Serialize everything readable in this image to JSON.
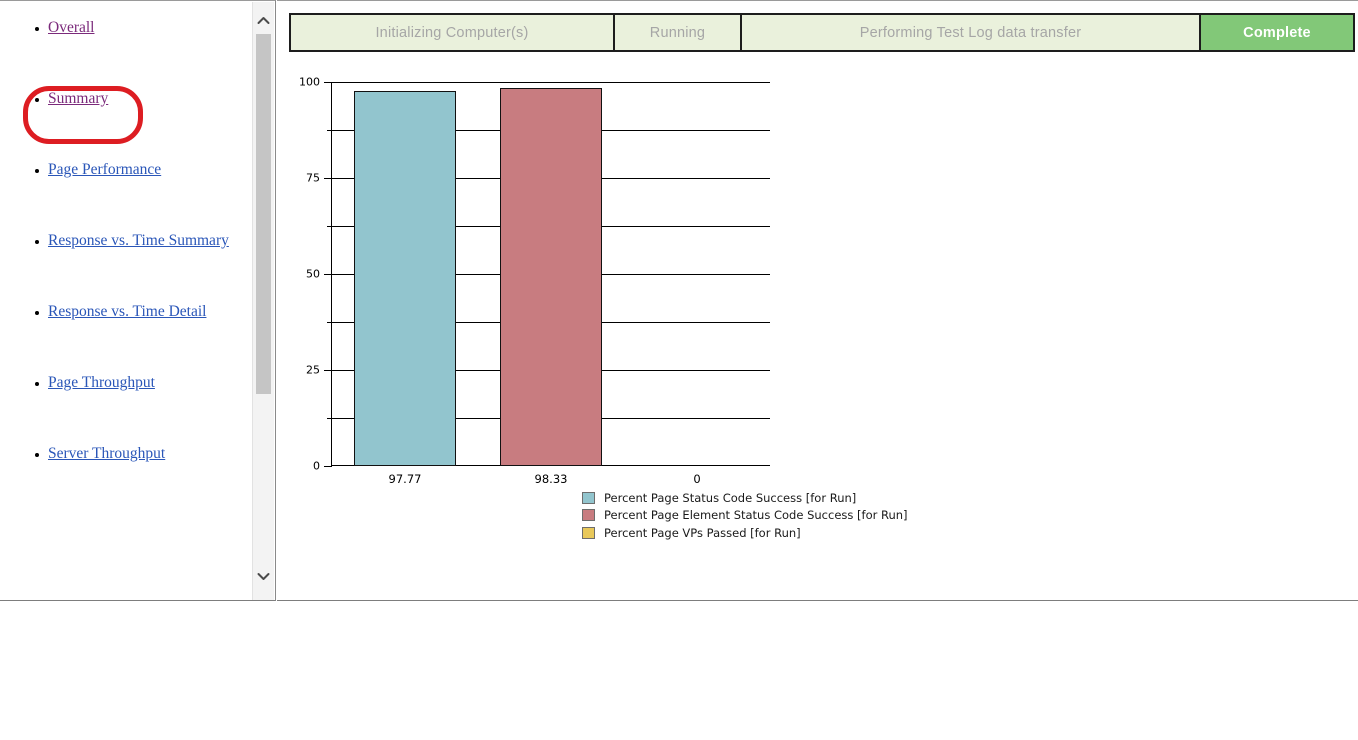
{
  "status_bar": {
    "segments": [
      {
        "label": "Initializing Computer(s)",
        "state": "pending"
      },
      {
        "label": "Running",
        "state": "pending"
      },
      {
        "label": "Performing Test Log data transfer",
        "state": "pending"
      },
      {
        "label": "Complete",
        "state": "done"
      }
    ],
    "pending_color": "#EAF1DC",
    "done_color": "#82C878",
    "pending_text_color": "#A6A6A6",
    "done_text_color": "#FFFFFF"
  },
  "sidebar": {
    "items": [
      {
        "label": "Overall",
        "state": "visited",
        "highlighted": true
      },
      {
        "label": "Summary",
        "state": "visited",
        "highlighted": false
      },
      {
        "label": "Page Performance",
        "state": "unvisited",
        "highlighted": false
      },
      {
        "label": "Response vs. Time Summary",
        "state": "unvisited",
        "highlighted": false
      },
      {
        "label": "Response vs. Time Detail",
        "state": "unvisited",
        "highlighted": false
      },
      {
        "label": "Page Throughput",
        "state": "unvisited",
        "highlighted": false
      },
      {
        "label": "Server Throughput",
        "state": "unvisited",
        "highlighted": false
      }
    ],
    "visited_color": "#7B2A7B",
    "unvisited_color": "#2A56B8",
    "highlight_color": "#DD1D22",
    "scrollbar": {
      "up_arrow": "chevron-up-icon",
      "down_arrow": "chevron-down-icon"
    }
  },
  "chart_data": {
    "type": "bar",
    "title": "",
    "xlabel": "",
    "ylabel": "",
    "ylim": [
      0,
      100
    ],
    "yticks": [
      0,
      25,
      50,
      75,
      100
    ],
    "ytick_labels": [
      "0",
      "25",
      "50",
      "75",
      "100"
    ],
    "minor_gridlines": [
      12.5,
      37.5,
      62.5,
      87.5
    ],
    "major_gridlines": [
      25,
      50,
      75,
      100
    ],
    "grid": true,
    "legend_position": "below",
    "categories": [
      "97.77",
      "98.33",
      "0"
    ],
    "values": [
      97.77,
      98.33,
      0
    ],
    "series": [
      {
        "name": "Percent Page Status Code Success [for Run]",
        "value": 97.77,
        "label": "97.77",
        "color": "#92C5CE"
      },
      {
        "name": "Percent Page Element Status Code Success [for Run]",
        "value": 98.33,
        "label": "98.33",
        "color": "#C87C80"
      },
      {
        "name": "Percent Page VPs Passed [for Run]",
        "value": 0,
        "label": "0",
        "color": "#E8C85A"
      }
    ]
  }
}
